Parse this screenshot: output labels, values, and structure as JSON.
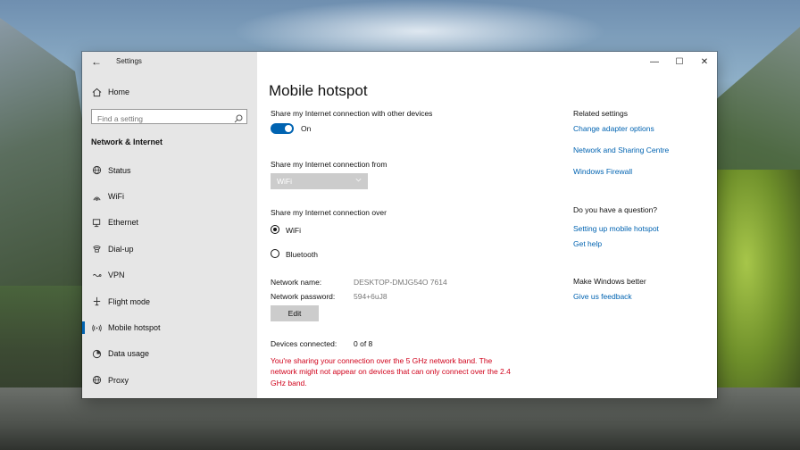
{
  "window": {
    "app_title": "Settings",
    "back_label": "←",
    "controls": {
      "minimize": "—",
      "maximize": "☐",
      "close": "✕"
    }
  },
  "sidebar": {
    "home_label": "Home",
    "search_placeholder": "Find a setting",
    "section_header": "Network & Internet",
    "items": [
      {
        "label": "Status",
        "icon": "globe-icon",
        "selected": false
      },
      {
        "label": "WiFi",
        "icon": "wifi-icon",
        "selected": false
      },
      {
        "label": "Ethernet",
        "icon": "ethernet-icon",
        "selected": false
      },
      {
        "label": "Dial-up",
        "icon": "dialup-icon",
        "selected": false
      },
      {
        "label": "VPN",
        "icon": "vpn-icon",
        "selected": false
      },
      {
        "label": "Flight mode",
        "icon": "airplane-icon",
        "selected": false
      },
      {
        "label": "Mobile hotspot",
        "icon": "hotspot-icon",
        "selected": true
      },
      {
        "label": "Data usage",
        "icon": "data-usage-icon",
        "selected": false
      },
      {
        "label": "Proxy",
        "icon": "proxy-globe-icon",
        "selected": false
      }
    ]
  },
  "main": {
    "title": "Mobile hotspot",
    "share_label": "Share my Internet connection with other devices",
    "toggle_state": "On",
    "share_from_label": "Share my Internet connection from",
    "share_from_value": "WiFi",
    "share_over_label": "Share my Internet connection over",
    "options": [
      {
        "label": "WiFi",
        "checked": true
      },
      {
        "label": "Bluetooth",
        "checked": false
      }
    ],
    "network_name_label": "Network name:",
    "network_name_value": "DESKTOP-DMJG54O 7614",
    "network_password_label": "Network password:",
    "network_password_value": "594+6uJ8",
    "edit_label": "Edit",
    "devices_label": "Devices connected:",
    "devices_value": "0 of 8",
    "warning": "You're sharing your connection over the 5 GHz network band. The network might not appear on devices that can only connect over the 2.4 GHz band."
  },
  "related": {
    "header": "Related settings",
    "links": [
      "Change adapter options",
      "Network and Sharing Centre",
      "Windows Firewall"
    ],
    "question_header": "Do you have a question?",
    "question_links": [
      "Setting up mobile hotspot",
      "Get help"
    ],
    "better_header": "Make Windows better",
    "feedback_link": "Give us feedback"
  },
  "colors": {
    "accent": "#0063b1",
    "warning": "#d0021b",
    "sidebar_bg": "#e6e6e6"
  }
}
